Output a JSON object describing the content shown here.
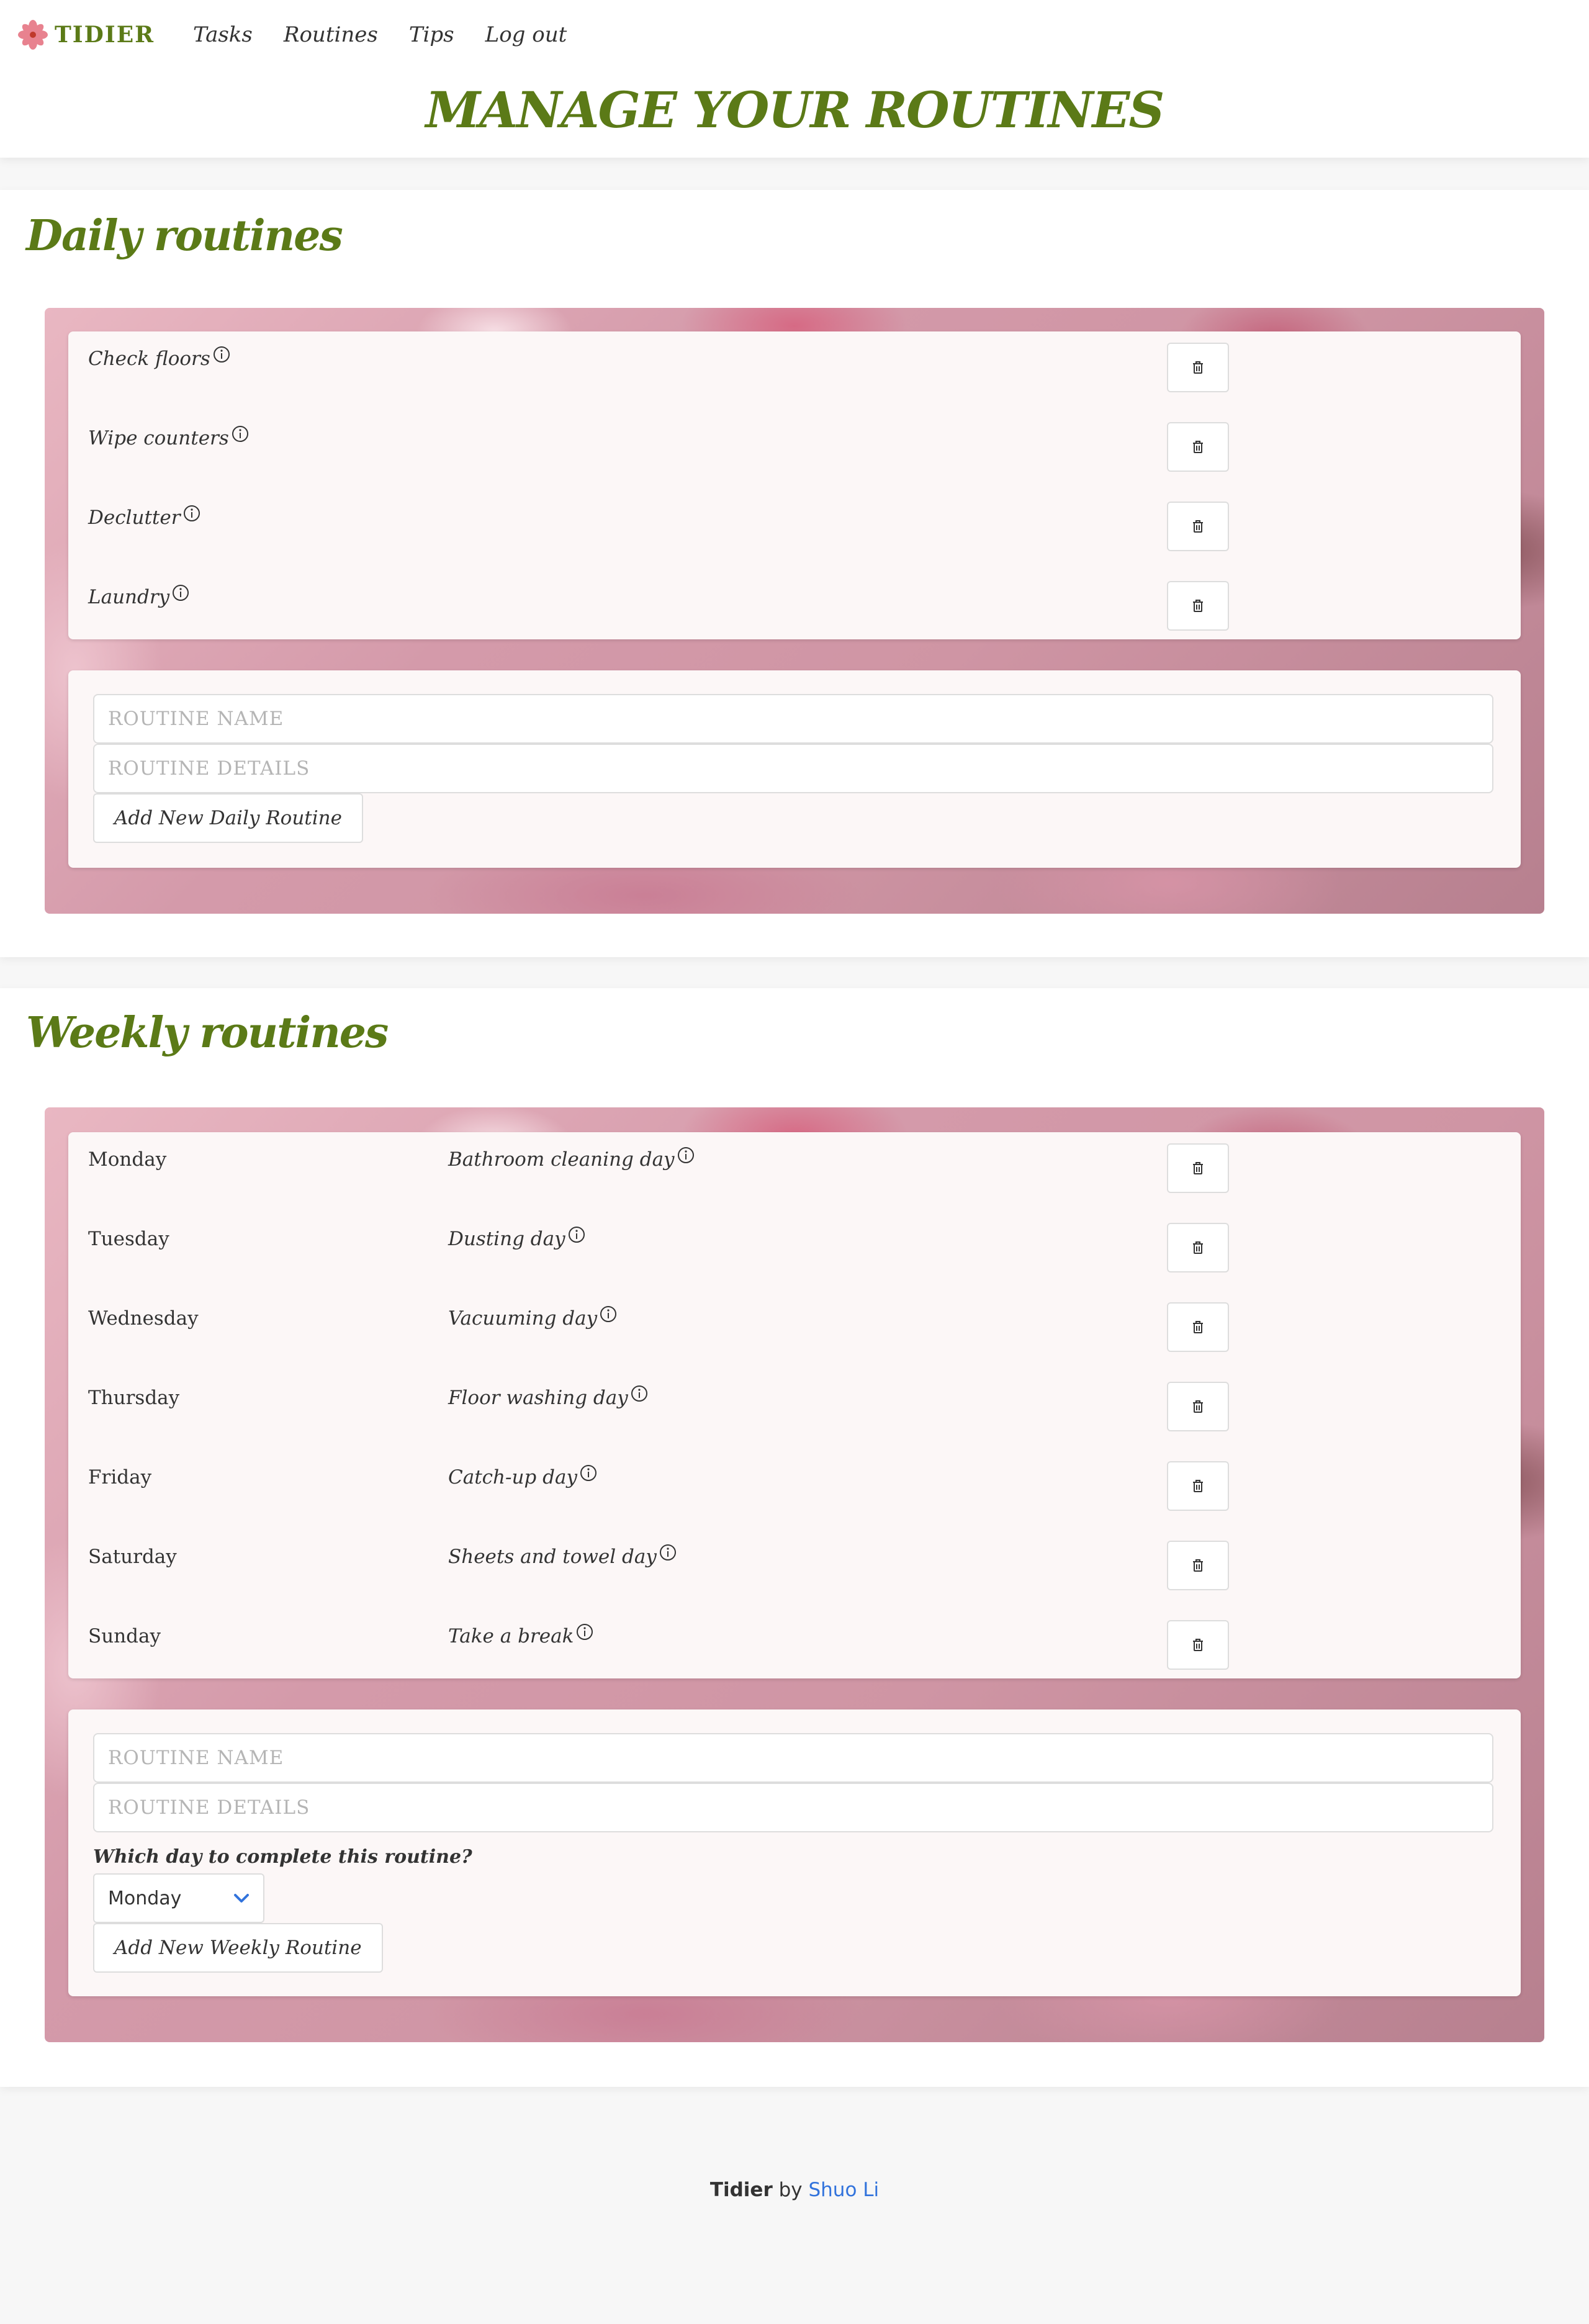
{
  "nav": {
    "brand": "TIDIER",
    "links": [
      "Tasks",
      "Routines",
      "Tips",
      "Log out"
    ]
  },
  "page_title": "Manage your routines",
  "daily": {
    "title": "Daily routines",
    "items": [
      "Check floors",
      "Wipe counters",
      "Declutter",
      "Laundry"
    ],
    "form": {
      "name_placeholder": "ROUTINE NAME",
      "details_placeholder": "ROUTINE DETAILS",
      "submit_label": "Add New Daily Routine"
    }
  },
  "weekly": {
    "title": "Weekly routines",
    "items": [
      {
        "day": "Monday",
        "task": "Bathroom cleaning day"
      },
      {
        "day": "Tuesday",
        "task": "Dusting day"
      },
      {
        "day": "Wednesday",
        "task": "Vacuuming day"
      },
      {
        "day": "Thursday",
        "task": "Floor washing day"
      },
      {
        "day": "Friday",
        "task": "Catch-up day"
      },
      {
        "day": "Saturday",
        "task": "Sheets and towel day"
      },
      {
        "day": "Sunday",
        "task": "Take a break"
      }
    ],
    "form": {
      "name_placeholder": "ROUTINE NAME",
      "details_placeholder": "ROUTINE DETAILS",
      "day_question": "Which day to complete this routine?",
      "day_selected": "Monday",
      "submit_label": "Add New Weekly Routine"
    }
  },
  "footer": {
    "brand": "Tidier",
    "by": "by",
    "author": "Shuo Li"
  },
  "colors": {
    "brand_green": "#5b7a17",
    "link_blue": "#3273dc",
    "card_bg": "#fcf7f7"
  },
  "icons": {
    "row_info": "info-circle-icon",
    "row_delete": "trash-icon",
    "select_arrow": "chevron-down-icon",
    "logo": "flower-icon"
  }
}
